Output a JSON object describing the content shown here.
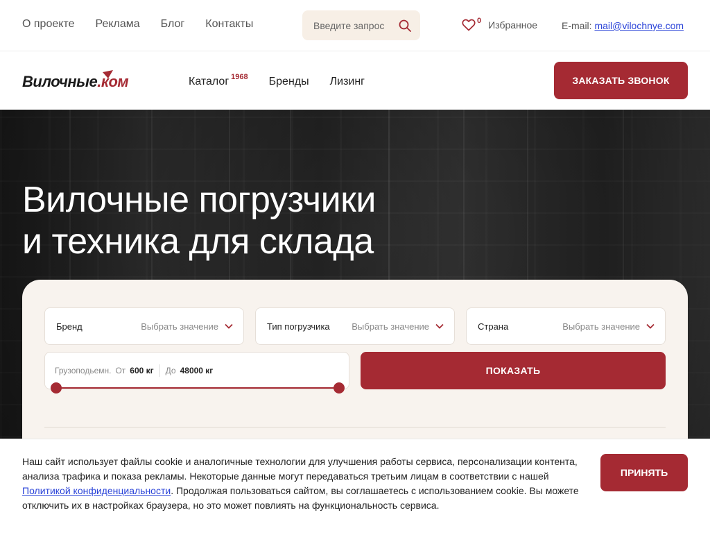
{
  "topbar": {
    "nav": [
      "О проекте",
      "Реклама",
      "Блог",
      "Контакты"
    ],
    "search_placeholder": "Введите запрос",
    "favorites_count": "0",
    "favorites_label": "Избранное",
    "email_label": "E-mail:",
    "email_value": "mail@vilochnye.com"
  },
  "header": {
    "logo_main": "Вилочные",
    "logo_dot": ".",
    "logo_suffix": "ком",
    "nav": [
      {
        "label": "Каталог",
        "badge": "1968"
      },
      {
        "label": "Бренды"
      },
      {
        "label": "Лизинг"
      }
    ],
    "call_button": "ЗАКАЗАТЬ ЗВОНОК"
  },
  "hero": {
    "title_line1": "Вилочные погрузчики",
    "title_line2": "и техника для склада"
  },
  "filters": {
    "brand": {
      "label": "Бренд",
      "value": "Выбрать значение"
    },
    "type": {
      "label": "Тип погрузчика",
      "value": "Выбрать значение"
    },
    "country": {
      "label": "Страна",
      "value": "Выбрать значение"
    },
    "capacity": {
      "label": "Грузоподьемн.",
      "from_label": "От",
      "from_value": "600 кг",
      "to_label": "До",
      "to_value": "48000 кг"
    },
    "show_button": "ПОКАЗАТЬ"
  },
  "cookie": {
    "text_before": "Наш сайт использует файлы cookie и аналогичные технологии для улучшения работы сервиса, персонализации контента, анализа трафика и показа рекламы. Некоторые данные могут передаваться третьим лицам в соответствии с нашей ",
    "link": "Политикой конфиденциальности",
    "text_after": ". Продолжая пользоваться сайтом, вы соглашаетесь с использованием cookie. Вы можете отключить их в настройках браузера, но это может повлиять на функциональность сервиса.",
    "accept_button": "ПРИНЯТЬ"
  },
  "colors": {
    "accent": "#a52a33",
    "link": "#2a43d8",
    "card_bg": "#f8f3ee",
    "search_bg": "#f7efe6"
  }
}
